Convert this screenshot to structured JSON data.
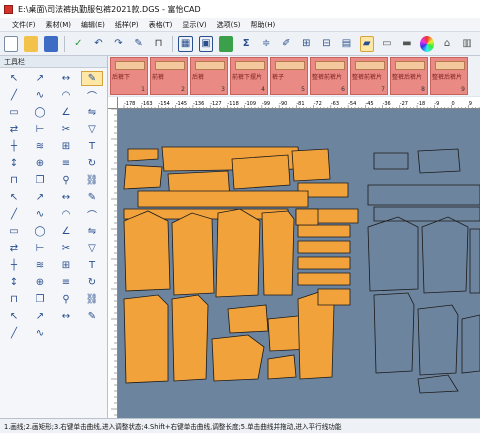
{
  "window": {
    "title": "E:\\桌面\\司法裤执勤服包裤2021款.DGS - 富怡CAD"
  },
  "menu": [
    {
      "label": "文件(F)"
    },
    {
      "label": "素材(M)"
    },
    {
      "label": "编辑(E)"
    },
    {
      "label": "纸样(P)"
    },
    {
      "label": "表格(T)"
    },
    {
      "label": "显示(V)"
    },
    {
      "label": "选项(S)"
    },
    {
      "label": "帮助(H)"
    }
  ],
  "toolbar_icons": [
    "new-file-icon",
    "open-folder-icon",
    "save-icon",
    "wand-icon",
    "undo-icon",
    "redo-icon",
    "pencil-icon",
    "ruler-icon",
    "grid-icon",
    "layout-icon",
    "piece-icon",
    "sum-icon",
    "measure-icon",
    "brush-icon",
    "table-icon",
    "scale-icon",
    "marker-icon",
    "press-icon",
    "knit-icon",
    "print-icon",
    "color-wheel-icon",
    "hanger-icon",
    "sheet-icon"
  ],
  "toolbox": {
    "title": "工具栏",
    "tools": [
      "select-icon",
      "adjust-icon",
      "pointer-icon",
      "smart-pen-icon",
      "line-icon",
      "curve-icon",
      "arc-icon",
      "bezier-icon",
      "rect-icon",
      "circle-icon",
      "angle-icon",
      "symmetry-icon",
      "mirror-icon",
      "measure-icon",
      "scissors-icon",
      "dart-icon",
      "notch-icon",
      "seam-icon",
      "align-icon",
      "text-icon",
      "grain-icon",
      "drill-icon",
      "pleat-icon",
      "rotate-icon",
      "fold-icon",
      "copy-icon",
      "zoom-icon",
      "link-icon",
      "shape-a-icon",
      "shape-b-icon",
      "shape-c-icon",
      "shape-d-icon",
      "shape-e-icon",
      "shape-f-icon",
      "shape-g-icon",
      "shape-h-icon",
      "shape-i-icon",
      "shape-j-icon",
      "shape-k-icon",
      "shape-l-icon",
      "shape-m-icon",
      "shape-n-icon",
      "shape-o-icon",
      "shape-p-icon",
      "shape-q-icon",
      "shape-r-icon",
      "shape-s-icon",
      "shape-t-icon",
      "shape-u-icon",
      "shape-v-icon",
      "shape-w-icon",
      "shape-x-icon",
      "shape-y-icon",
      "shape-z-icon",
      "tool-a-icon",
      "tool-b-icon",
      "tool-c-icon",
      "tool-d-icon",
      "tool-e-icon",
      "tool-f-icon",
      "tool-g-icon",
      "tool-h-icon"
    ]
  },
  "pieces": [
    {
      "name": "后裤下",
      "num": "1"
    },
    {
      "name": "前裤",
      "num": "2"
    },
    {
      "name": "后裤",
      "num": "3"
    },
    {
      "name": "前裤下摆片",
      "num": "4"
    },
    {
      "name": "裤子",
      "num": "5"
    },
    {
      "name": "整裤前裤片",
      "num": "6"
    },
    {
      "name": "整裤前裤片",
      "num": "7"
    },
    {
      "name": "整裤后裤片",
      "num": "8"
    },
    {
      "name": "整裤后裤片",
      "num": "9"
    }
  ],
  "ruler_labels": [
    "-178",
    "-163",
    "-154",
    "-145",
    "-136",
    "-127",
    "-118",
    "-109",
    "-99",
    "-90",
    "-81",
    "-72",
    "-63",
    "-54",
    "-45",
    "-36",
    "-27",
    "-18",
    "-9",
    "0",
    "9"
  ],
  "status": "1.画线;2.画矩形;3.右键单击曲线,进入调整状态;4.Shift+右键单击曲线,调整长度;5.单击曲线并拖动,进入平行线功能",
  "colors": {
    "piece_fill": "#f1a23a",
    "piece_outline": "#222222",
    "canvas_bg": "#6d849e",
    "slot_fill": "#e98a85"
  }
}
